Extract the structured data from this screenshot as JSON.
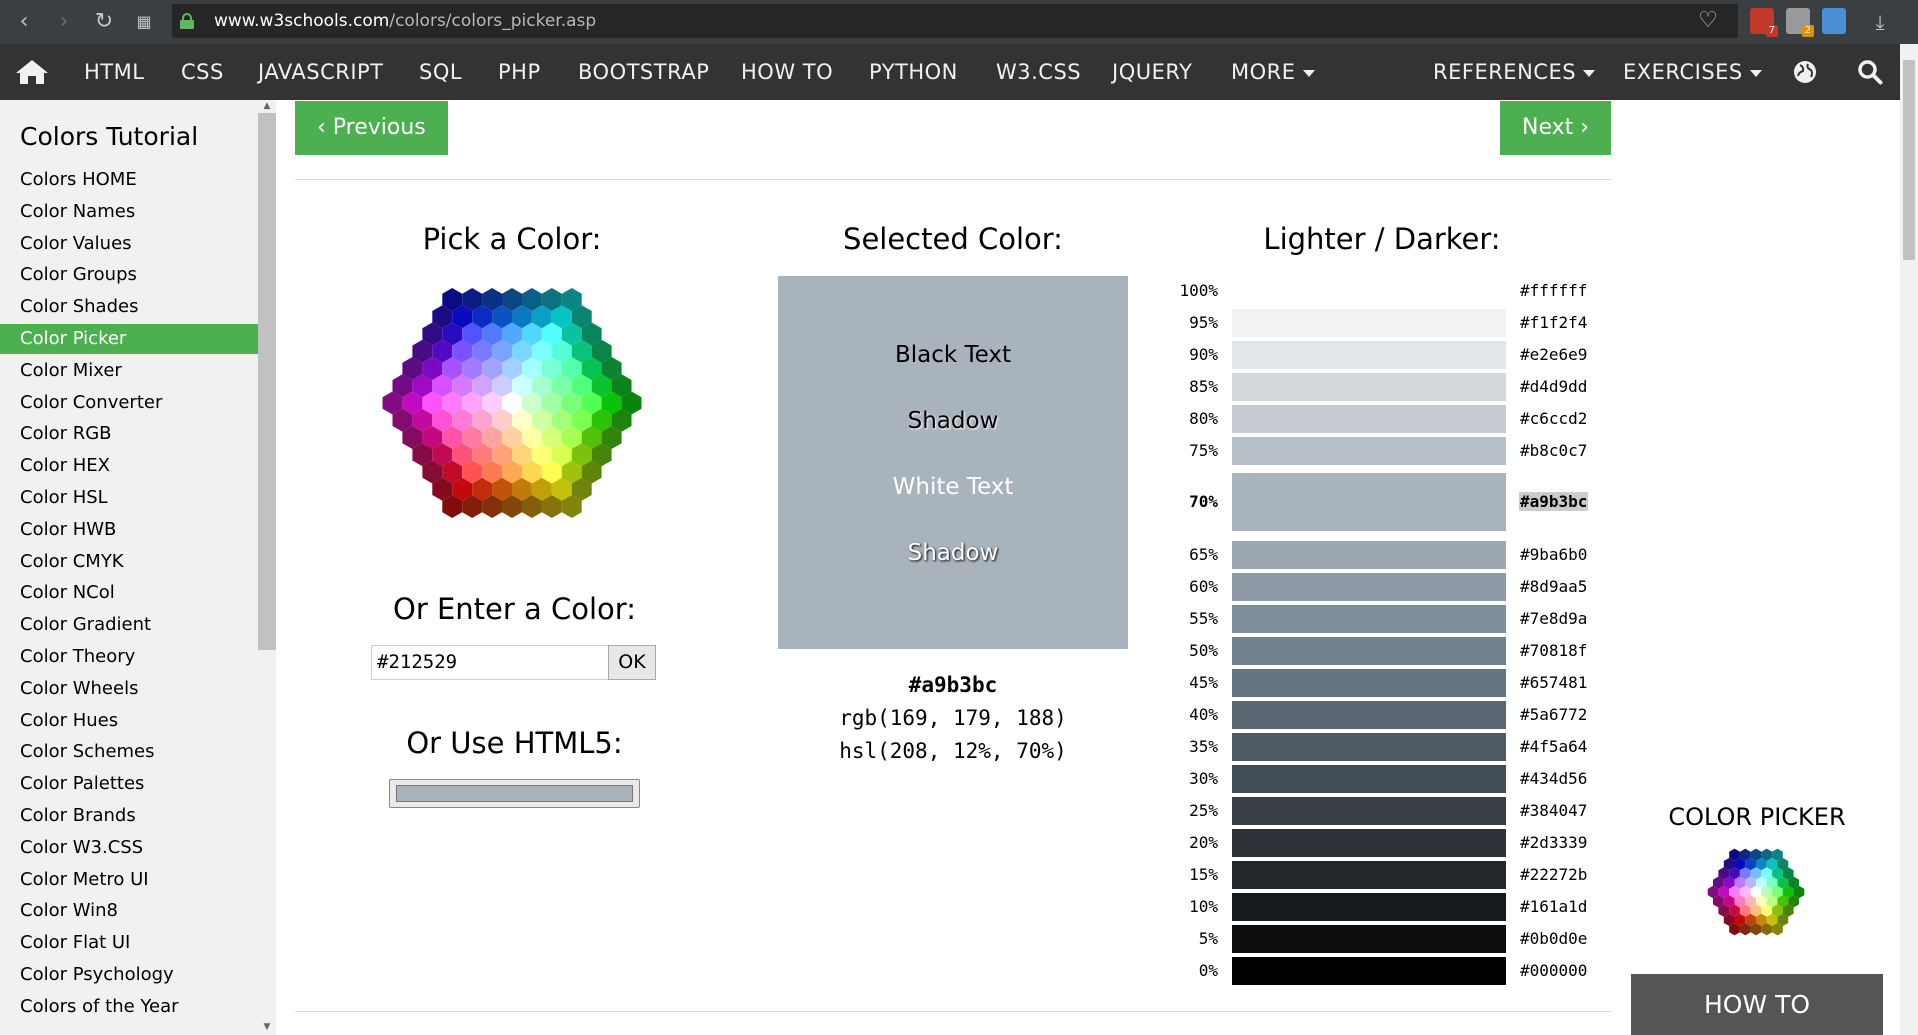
{
  "browser": {
    "url_host": "www.w3schools.com",
    "url_path": "/colors/colors_picker.asp",
    "extension_badges": [
      "7",
      "2"
    ]
  },
  "topnav": {
    "items": [
      "HTML",
      "CSS",
      "JAVASCRIPT",
      "SQL",
      "PHP",
      "BOOTSTRAP",
      "HOW TO",
      "PYTHON",
      "W3.CSS",
      "JQUERY",
      "MORE"
    ],
    "right_items": [
      "REFERENCES",
      "EXERCISES"
    ]
  },
  "sidebar": {
    "title": "Colors Tutorial",
    "items": [
      "Colors HOME",
      "Color Names",
      "Color Values",
      "Color Groups",
      "Color Shades",
      "Color Picker",
      "Color Mixer",
      "Color Converter",
      "Color RGB",
      "Color HEX",
      "Color HSL",
      "Color HWB",
      "Color CMYK",
      "Color NCol",
      "Color Gradient",
      "Color Theory",
      "Color Wheels",
      "Color Hues",
      "Color Schemes",
      "Color Palettes",
      "Color Brands",
      "Color W3.CSS",
      "Color Metro UI",
      "Color Win8",
      "Color Flat UI",
      "Color Psychology",
      "Colors of the Year"
    ],
    "active_item": "Color Picker"
  },
  "nav_buttons": {
    "previous": "‹ Previous",
    "next": "Next ›"
  },
  "picker": {
    "heading": "Pick a Color:",
    "enter_heading": "Or Enter a Color:",
    "input_value": "#212529",
    "ok_label": "OK",
    "html5_heading": "Or Use HTML5:",
    "html5_value": "#a9b3bc"
  },
  "selected": {
    "heading": "Selected Color:",
    "color": "#a9b3bc",
    "black_text": "Black Text",
    "black_shadow": "Shadow",
    "white_text": "White Text",
    "white_shadow": "Shadow",
    "hex": "#a9b3bc",
    "rgb": "rgb(169, 179, 188)",
    "hsl": "hsl(208, 12%, 70%)"
  },
  "shades": {
    "heading": "Lighter / Darker:",
    "selected_percent": "70%",
    "rows": [
      {
        "percent": "100%",
        "hex": "#ffffff"
      },
      {
        "percent": "95%",
        "hex": "#f1f2f4"
      },
      {
        "percent": "90%",
        "hex": "#e2e6e9"
      },
      {
        "percent": "85%",
        "hex": "#d4d9dd"
      },
      {
        "percent": "80%",
        "hex": "#c6ccd2"
      },
      {
        "percent": "75%",
        "hex": "#b8c0c7"
      },
      {
        "percent": "70%",
        "hex": "#a9b3bc"
      },
      {
        "percent": "65%",
        "hex": "#9ba6b0"
      },
      {
        "percent": "60%",
        "hex": "#8d9aa5"
      },
      {
        "percent": "55%",
        "hex": "#7e8d9a"
      },
      {
        "percent": "50%",
        "hex": "#70818f"
      },
      {
        "percent": "45%",
        "hex": "#657481"
      },
      {
        "percent": "40%",
        "hex": "#5a6772"
      },
      {
        "percent": "35%",
        "hex": "#4f5a64"
      },
      {
        "percent": "30%",
        "hex": "#434d56"
      },
      {
        "percent": "25%",
        "hex": "#384047"
      },
      {
        "percent": "20%",
        "hex": "#2d3339"
      },
      {
        "percent": "15%",
        "hex": "#22272b"
      },
      {
        "percent": "10%",
        "hex": "#161a1d"
      },
      {
        "percent": "5%",
        "hex": "#0b0d0e"
      },
      {
        "percent": "0%",
        "hex": "#000000"
      }
    ]
  },
  "ad": {
    "title": "COLOR PICKER",
    "howto": "HOW TO"
  },
  "colors": {
    "brand_green": "#4caf50",
    "nav_bg": "#333333",
    "sidebar_bg": "#f1f1f1"
  }
}
